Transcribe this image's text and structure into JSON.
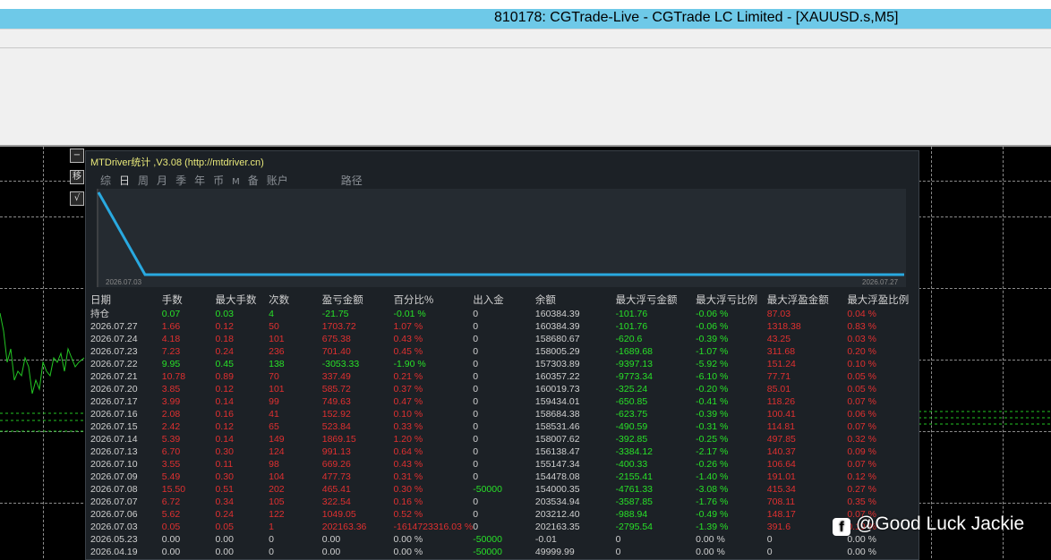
{
  "window": {
    "title": "810178: CGTrade-Live - CGTrade LC Limited - [XAUUSD.s,M5]"
  },
  "side_buttons": [
    "−",
    "移",
    "√"
  ],
  "panel": {
    "title": "MTDriver统计 ,V3.08 (http://mtdriver.cn)",
    "tabs": [
      "综",
      "日",
      "周",
      "月",
      "季",
      "年",
      "币",
      "M",
      "备",
      "账户",
      "路径"
    ],
    "active_tab": "日",
    "graph_start_label": "2026.07.03",
    "graph_end_label": "2026.07.27"
  },
  "chart_data": {
    "type": "line",
    "x": [
      "2026.07.03",
      "2026.07.27"
    ],
    "series": [
      {
        "values": [
          202163.35,
          0
        ]
      }
    ]
  },
  "table": {
    "headers": [
      "日期",
      "手数",
      "最大手数",
      "次数",
      "盈亏金额",
      "百分比%",
      "出入金",
      "余额",
      "最大浮亏金额",
      "最大浮亏比例",
      "最大浮盈金额",
      "最大浮盈比例"
    ],
    "rows": [
      {
        "cells": [
          "持仓",
          "0.07",
          "0.03",
          "4",
          "-21.75",
          "-0.01 %",
          "0",
          "160384.39",
          "-101.76",
          "-0.06 %",
          "87.03",
          "0.04 %"
        ],
        "tone": "green"
      },
      {
        "cells": [
          "2026.07.27",
          "1.66",
          "0.12",
          "50",
          "1703.72",
          "1.07 %",
          "0",
          "160384.39",
          "-101.76",
          "-0.06 %",
          "1318.38",
          "0.83 %"
        ],
        "tone": "red"
      },
      {
        "cells": [
          "2026.07.24",
          "4.18",
          "0.18",
          "101",
          "675.38",
          "0.43 %",
          "0",
          "158680.67",
          "-620.6",
          "-0.39 %",
          "43.25",
          "0.03 %"
        ],
        "tone": "red"
      },
      {
        "cells": [
          "2026.07.23",
          "7.23",
          "0.24",
          "236",
          "701.40",
          "0.45 %",
          "0",
          "158005.29",
          "-1689.68",
          "-1.07 %",
          "311.68",
          "0.20 %"
        ],
        "tone": "red"
      },
      {
        "cells": [
          "2026.07.22",
          "9.95",
          "0.45",
          "138",
          "-3053.33",
          "-1.90 %",
          "0",
          "157303.89",
          "-9397.13",
          "-5.92 %",
          "151.24",
          "0.10 %"
        ],
        "tone": "green"
      },
      {
        "cells": [
          "2026.07.21",
          "10.78",
          "0.89",
          "70",
          "337.49",
          "0.21 %",
          "0",
          "160357.22",
          "-9773.34",
          "-6.10 %",
          "77.71",
          "0.05 %"
        ],
        "tone": "red"
      },
      {
        "cells": [
          "2026.07.20",
          "3.85",
          "0.12",
          "101",
          "585.72",
          "0.37 %",
          "0",
          "160019.73",
          "-325.24",
          "-0.20 %",
          "85.01",
          "0.05 %"
        ],
        "tone": "red"
      },
      {
        "cells": [
          "2026.07.17",
          "3.99",
          "0.14",
          "99",
          "749.63",
          "0.47 %",
          "0",
          "159434.01",
          "-650.85",
          "-0.41 %",
          "118.26",
          "0.07 %"
        ],
        "tone": "red"
      },
      {
        "cells": [
          "2026.07.16",
          "2.08",
          "0.16",
          "41",
          "152.92",
          "0.10 %",
          "0",
          "158684.38",
          "-623.75",
          "-0.39 %",
          "100.41",
          "0.06 %"
        ],
        "tone": "red"
      },
      {
        "cells": [
          "2026.07.15",
          "2.42",
          "0.12",
          "65",
          "523.84",
          "0.33 %",
          "0",
          "158531.46",
          "-490.59",
          "-0.31 %",
          "114.81",
          "0.07 %"
        ],
        "tone": "red"
      },
      {
        "cells": [
          "2026.07.14",
          "5.39",
          "0.14",
          "149",
          "1869.15",
          "1.20 %",
          "0",
          "158007.62",
          "-392.85",
          "-0.25 %",
          "497.85",
          "0.32 %"
        ],
        "tone": "red"
      },
      {
        "cells": [
          "2026.07.13",
          "6.70",
          "0.30",
          "124",
          "991.13",
          "0.64 %",
          "0",
          "156138.47",
          "-3384.12",
          "-2.17 %",
          "140.37",
          "0.09 %"
        ],
        "tone": "red"
      },
      {
        "cells": [
          "2026.07.10",
          "3.55",
          "0.11",
          "98",
          "669.26",
          "0.43 %",
          "0",
          "155147.34",
          "-400.33",
          "-0.26 %",
          "106.64",
          "0.07 %"
        ],
        "tone": "red"
      },
      {
        "cells": [
          "2026.07.09",
          "5.49",
          "0.30",
          "104",
          "477.73",
          "0.31 %",
          "0",
          "154478.08",
          "-2155.41",
          "-1.40 %",
          "191.01",
          "0.12 %"
        ],
        "tone": "red"
      },
      {
        "cells": [
          "2026.07.08",
          "15.50",
          "0.51",
          "202",
          "465.41",
          "0.30 %",
          "-50000",
          "154000.35",
          "-4761.33",
          "-3.08 %",
          "415.34",
          "0.27 %"
        ],
        "tone": "red"
      },
      {
        "cells": [
          "2026.07.07",
          "6.72",
          "0.34",
          "105",
          "322.54",
          "0.16 %",
          "0",
          "203534.94",
          "-3587.85",
          "-1.76 %",
          "708.11",
          "0.35 %"
        ],
        "tone": "red"
      },
      {
        "cells": [
          "2026.07.06",
          "5.62",
          "0.24",
          "122",
          "1049.05",
          "0.52 %",
          "0",
          "203212.40",
          "-988.94",
          "-0.49 %",
          "148.17",
          "0.07 %"
        ],
        "tone": "red"
      },
      {
        "cells": [
          "2026.07.03",
          "0.05",
          "0.05",
          "1",
          "202163.36",
          "-1614723316.03 %",
          "0",
          "202163.35",
          "-2795.54",
          "-1.39 %",
          "391.6",
          "0.19 %"
        ],
        "tone": "red"
      },
      {
        "cells": [
          "2026.05.23",
          "0.00",
          "0.00",
          "0",
          "0.00",
          "0.00 %",
          "-50000",
          "-0.01",
          "0",
          "0.00 %",
          "0",
          "0.00 %"
        ],
        "tone": "neutral"
      },
      {
        "cells": [
          "2026.04.19",
          "0.00",
          "0.00",
          "0",
          "0.00",
          "0.00 %",
          "-50000",
          "49999.99",
          "0",
          "0.00 %",
          "0",
          "0.00 %"
        ],
        "tone": "neutral"
      }
    ]
  },
  "watermark": {
    "text": "@Good Luck Jackie",
    "icon": "facebook-icon"
  },
  "colors": {
    "titlebar": "#6ec9e8",
    "positive": "#e03030",
    "negative": "#28e028",
    "graph_line": "#29a9e0"
  }
}
